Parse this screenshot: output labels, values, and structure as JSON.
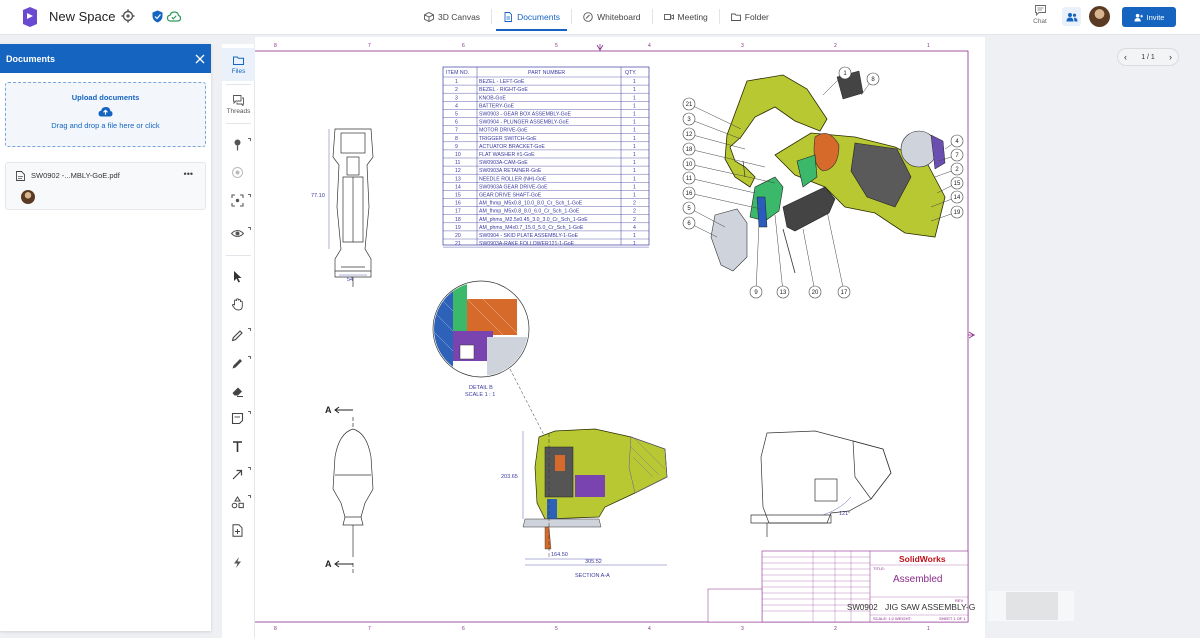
{
  "app": {
    "title": "New Space"
  },
  "nav": {
    "tabs": [
      {
        "label": "3D Canvas",
        "icon": "cube-icon"
      },
      {
        "label": "Documents",
        "icon": "document-icon",
        "active": true
      },
      {
        "label": "Whiteboard",
        "icon": "whiteboard-icon"
      },
      {
        "label": "Meeting",
        "icon": "video-icon"
      },
      {
        "label": "Folder",
        "icon": "folder-icon"
      }
    ]
  },
  "header_right": {
    "chat_label": "Chat",
    "invite_label": "Invite"
  },
  "docs": {
    "title": "Documents",
    "upload_title": "Upload documents",
    "upload_hint": "Drag and drop a file here or click",
    "files": [
      {
        "name": "SW0902 -...MBLY-GoE.pdf"
      }
    ]
  },
  "rail": {
    "tabs": [
      {
        "label": "Files"
      },
      {
        "label": "Threads"
      }
    ]
  },
  "pager": {
    "text": "1 / 1"
  },
  "drawing": {
    "bom_headers": [
      "ITEM NO.",
      "PART NUMBER",
      "QTY."
    ],
    "bom_rows": [
      [
        "1",
        "BEZEL - LEFT-GoE",
        "1"
      ],
      [
        "2",
        "BEZEL - RIGHT-GoE",
        "1"
      ],
      [
        "3",
        "KNOB-GoE",
        "1"
      ],
      [
        "4",
        "BATTERY-GoE",
        "1"
      ],
      [
        "5",
        "SW0903 - GEAR BOX ASSEMBLY-GoE",
        "1"
      ],
      [
        "6",
        "SW0904 - PLUNGER ASSEMBLY-GoE",
        "1"
      ],
      [
        "7",
        "MOTOR DRIVE-GoE",
        "1"
      ],
      [
        "8",
        "TRIGGER SWITCH-GoE",
        "1"
      ],
      [
        "9",
        "ACTUATOR BRACKET-GoE",
        "1"
      ],
      [
        "10",
        "FLAT WASHER #1-GoE",
        "1"
      ],
      [
        "11",
        "SW0903A-CAM-GoE",
        "1"
      ],
      [
        "12",
        "SW0903A RETAINER-GoE",
        "1"
      ],
      [
        "13",
        "NEEDLE ROLLER (NH)-GoE",
        "1"
      ],
      [
        "14",
        "SW0903A GEAR DRIVE-GoE",
        "1"
      ],
      [
        "15",
        "GEAR DRIVE SHAFT-GoE",
        "1"
      ],
      [
        "16",
        "AM_fhmp_M5x0.8_10.0_8.0_Cr_Sch_1-GoE",
        "2"
      ],
      [
        "17",
        "AM_fhmp_M5x0.8_8.0_6.0_Cr_Sch_1-GoE",
        "2"
      ],
      [
        "18",
        "AM_phms_M2.5x0.45_3.0_3.0_Cr_Sch_1-GoE",
        "2"
      ],
      [
        "19",
        "AM_phms_M4x0.7_15.0_5.0_Cr_Sch_1-GoE",
        "4"
      ],
      [
        "20",
        "SW0904 - SKID PLATE ASSEMBLY-1-GoE",
        "1"
      ],
      [
        "21",
        "SW0903A-RAKE FOLLOWER121-1-GoE",
        "1"
      ]
    ],
    "balloons": [
      "1",
      "8",
      "21",
      "3",
      "12",
      "18",
      "10",
      "11",
      "16",
      "5",
      "6",
      "9",
      "13",
      "20",
      "17",
      "4",
      "7",
      "2",
      "15",
      "14",
      "19"
    ],
    "dims": {
      "height_left": "77.10",
      "width_left": "54",
      "height_section": "203.65",
      "width1": "164.50",
      "width2": "305.52",
      "angle": "121°"
    },
    "section_marks": [
      "A",
      "A"
    ],
    "detail_label": "DETAIL B",
    "detail_scale": "SCALE 1 : 1",
    "section_label": "SECTION A-A",
    "title_block": {
      "brand": "SolidWorks",
      "title_caption": "TITLE:",
      "title": "Assembled",
      "dwg_no": "SW0902",
      "part_name": "JIG SAW ASSEMBLY-G",
      "rev": "REV",
      "scale": "SCALE: 1:2",
      "weight": "WEIGHT:",
      "sheet": "SHEET 1 OF 1"
    },
    "border_numbers": [
      "8",
      "7",
      "6",
      "5",
      "4",
      "3",
      "2",
      "1"
    ]
  },
  "colors": {
    "accent": "#1565c0",
    "part_green": "#b8c832",
    "drawing_border": "#8a2b8a",
    "drawing_ink": "#3a3aa0"
  }
}
